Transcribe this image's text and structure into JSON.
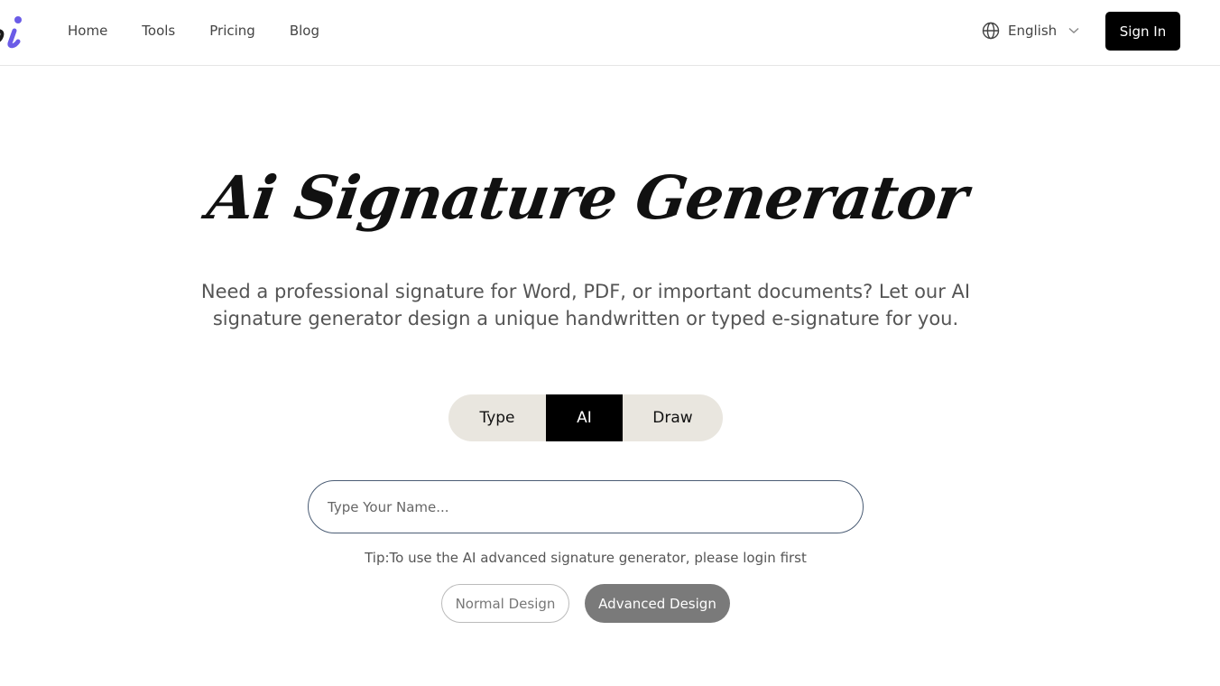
{
  "header": {
    "logo_icon": "signature-logo-icon",
    "nav": [
      {
        "label": "Home"
      },
      {
        "label": "Tools"
      },
      {
        "label": "Pricing"
      },
      {
        "label": "Blog"
      }
    ],
    "language": {
      "icon": "globe-icon",
      "label": "English",
      "chevron": "chevron-down-icon"
    },
    "sign_in_label": "Sign In"
  },
  "hero": {
    "title": "Ai Signature Generator",
    "subtitle": "Need a professional signature for Word, PDF, or important documents? Let our AI signature generator design a unique handwritten or typed e-signature for you."
  },
  "tabs": {
    "items": [
      "Type",
      "AI",
      "Draw"
    ],
    "active": "AI"
  },
  "form": {
    "name_placeholder": "Type Your Name...",
    "name_value": "",
    "tip": "Tip:To use the AI advanced signature generator, please login first",
    "normal_design_label": "Normal Design",
    "advanced_design_label": "Advanced Design"
  },
  "colors": {
    "logo_dark": "#1a1a1a",
    "logo_accent": "#6b5ce7",
    "tab_bg": "#e9e6df",
    "active_tab": "#000000",
    "advanced_button": "#7a7a7a"
  }
}
